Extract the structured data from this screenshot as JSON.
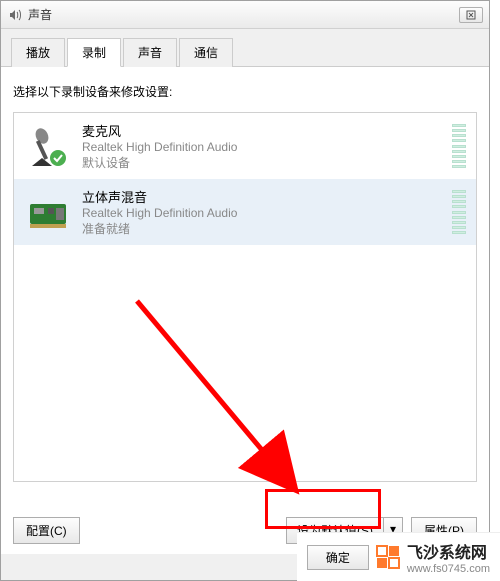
{
  "window": {
    "title": "声音"
  },
  "tabs": [
    "播放",
    "录制",
    "声音",
    "通信"
  ],
  "active_tab_index": 1,
  "instruction": "选择以下录制设备来修改设置:",
  "devices": [
    {
      "name": "麦克风",
      "sub": "Realtek High Definition Audio",
      "status": "默认设备",
      "selected": false,
      "icon": "microphone"
    },
    {
      "name": "立体声混音",
      "sub": "Realtek High Definition Audio",
      "status": "准备就绪",
      "selected": true,
      "icon": "soundcard"
    }
  ],
  "buttons": {
    "configure": "配置(C)",
    "set_default": "设为默认值(S)",
    "properties": "属性(P)",
    "ok": "确定"
  },
  "brand": {
    "name": "飞沙系统网",
    "url": "www.fs0745.com"
  }
}
